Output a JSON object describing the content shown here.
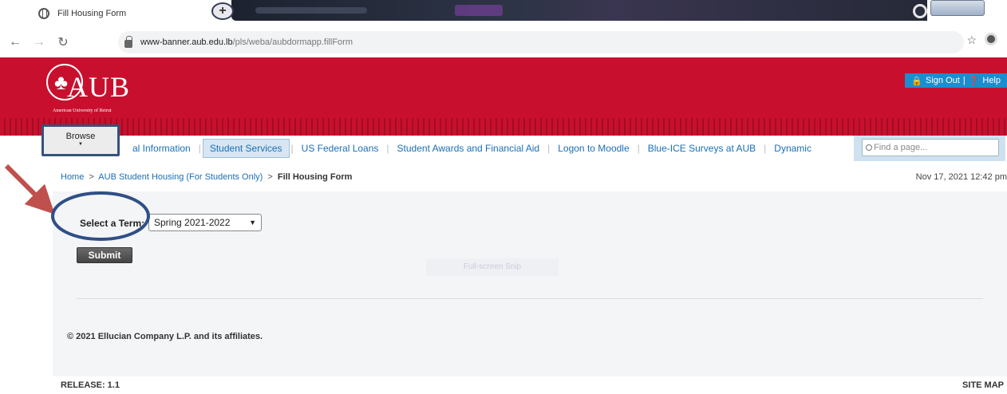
{
  "browser": {
    "tab_title": "Fill Housing Form",
    "tab_close": "×",
    "new_tab": "+",
    "url_host": "www-banner.aub.edu.lb",
    "url_path": "/pls/weba/aubdormapp.fillForm",
    "icons": [
      "globe-icon",
      "back-icon",
      "forward-icon",
      "reload-icon",
      "lock-icon",
      "star-icon",
      "account-icon"
    ]
  },
  "header": {
    "logo_text": "AUB",
    "logo_subtitle": "American University of Beirut",
    "signout_label": "Sign Out",
    "help_label": "Help",
    "brand_color": "#c8102e",
    "accent_color": "#1a8fd0"
  },
  "browse": {
    "label": "Browse"
  },
  "menu": {
    "items": [
      {
        "label": "al Information",
        "active": false
      },
      {
        "label": "Student Services",
        "active": true
      },
      {
        "label": "US Federal Loans",
        "active": false
      },
      {
        "label": "Student Awards and Financial Aid",
        "active": false
      },
      {
        "label": "Logon to Moodle",
        "active": false
      },
      {
        "label": "Blue-ICE Surveys at AUB",
        "active": false
      },
      {
        "label": "Dynamic",
        "active": false
      }
    ],
    "find_placeholder": "Find a page..."
  },
  "breadcrumb": {
    "home": "Home",
    "sep": ">",
    "parent": "AUB Student Housing (For Students Only)",
    "current": "Fill Housing Form",
    "datetime": "Nov 17, 2021 12:42 pm"
  },
  "form": {
    "select_label": "Select a Term:",
    "selected_term": "Spring 2021-2022",
    "submit_label": "Submit",
    "ghost_text": "Full-screen Snip"
  },
  "footer": {
    "copyright": "© 2021 Ellucian Company L.P. and its affiliates.",
    "release": "RELEASE: 1.1",
    "sitemap": "SITE MAP"
  },
  "annotation": {
    "arrow_color": "#c0504d",
    "ellipse_color": "#2f4f86"
  }
}
